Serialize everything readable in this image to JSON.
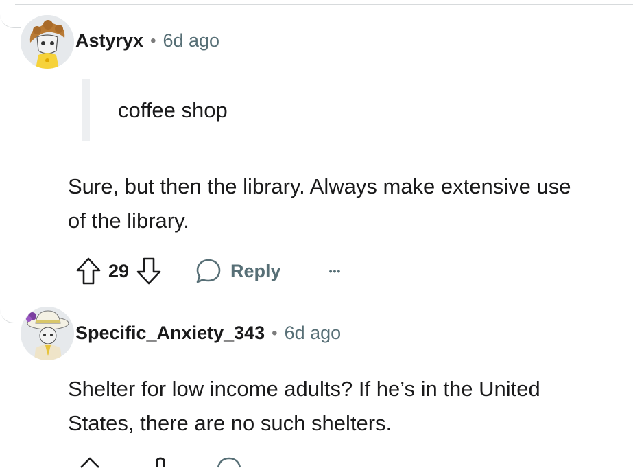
{
  "comments": [
    {
      "username": "Astyryx",
      "separator": "•",
      "time": "6d ago",
      "quote": "coffee shop",
      "body_lines": [
        "Sure, but then the library. Always make extensive use",
        "of the library."
      ],
      "votes": "29",
      "reply_label": "Reply",
      "more_label": "•••"
    },
    {
      "username": "Specific_Anxiety_343",
      "separator": "•",
      "time": "6d ago",
      "body_lines": [
        "Shelter for low income adults? If he’s in the United",
        "States, there are no such shelters."
      ]
    }
  ],
  "icons": {
    "upvote": "arrow-up-outline-icon",
    "downvote": "arrow-down-outline-icon",
    "reply": "speech-bubble-icon",
    "more": "horizontal-ellipsis-icon"
  },
  "colors": {
    "text": "#1a1a1b",
    "meta": "#576f76",
    "thread_line": "#d7dadc",
    "quote_bar": "#edeff1"
  }
}
